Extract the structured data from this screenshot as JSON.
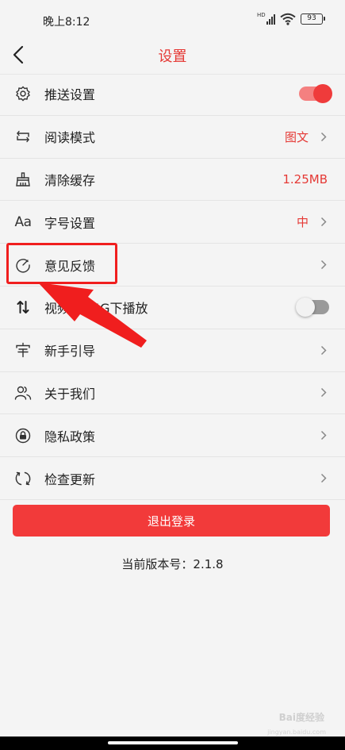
{
  "status_bar": {
    "time": "晚上8:12",
    "signal_tag": "HD",
    "battery": "93"
  },
  "header": {
    "title": "设置"
  },
  "settings": [
    {
      "icon": "gear-icon",
      "label": "推送设置",
      "control": "toggle",
      "enabled": true
    },
    {
      "icon": "reading-mode-icon",
      "label": "阅读模式",
      "value": "图文",
      "control": "chevron"
    },
    {
      "icon": "broom-icon",
      "label": "清除缓存",
      "value": "1.25MB",
      "control": "none"
    },
    {
      "icon": "font-size-icon",
      "icon_text": "Aa",
      "label": "字号设置",
      "value": "中",
      "control": "chevron"
    },
    {
      "icon": "feedback-icon",
      "label": "意见反馈",
      "control": "chevron"
    },
    {
      "icon": "up-down-arrows-icon",
      "label": "视频3G/4G下播放",
      "control": "toggle",
      "enabled": false
    },
    {
      "icon": "guide-icon",
      "label": "新手引导",
      "control": "chevron"
    },
    {
      "icon": "users-icon",
      "label": "关于我们",
      "control": "chevron"
    },
    {
      "icon": "lock-icon",
      "label": "隐私政策",
      "control": "chevron"
    },
    {
      "icon": "refresh-icon",
      "label": "检查更新",
      "control": "chevron"
    }
  ],
  "logout_label": "退出登录",
  "version_text": "当前版本号：2.1.8",
  "watermark": {
    "brand": "Bai度经验",
    "url": "jingyan.baidu.com"
  },
  "colors": {
    "accent": "#e53935",
    "button": "#f23a3a",
    "annotation": "#f01e1e"
  }
}
